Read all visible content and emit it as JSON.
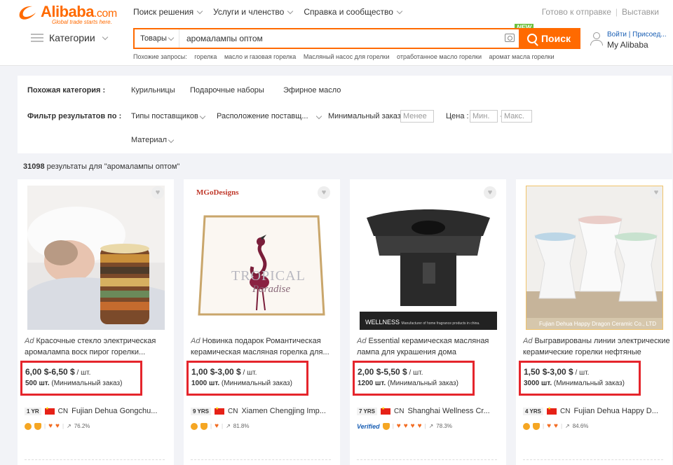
{
  "header": {
    "logo_text": "Alibaba",
    "logo_suffix": ".com",
    "logo_tagline": "Global trade starts here.",
    "nav": [
      {
        "label": "Поиск решения"
      },
      {
        "label": "Услуги и членство"
      },
      {
        "label": "Справка и сообщество"
      }
    ],
    "ready_to_ship": "Готово к отправке",
    "exhibitions": "Выставки",
    "categories_label": "Категории",
    "search": {
      "category": "Товары",
      "query": "аромалампы оптом",
      "button": "Поиск",
      "new_badge": "NEW"
    },
    "account": {
      "links": "Войти | Присоед...",
      "my": "My Alibaba"
    },
    "related_label": "Похожие запросы:",
    "related": [
      "горелка",
      "масло и газовая горелка",
      "Масляный насос для горелки",
      "отработанное масло горелки",
      "аромат масла горелки"
    ]
  },
  "filters": {
    "similar_category_label": "Похожая категория :",
    "similar_categories": [
      "Курильницы",
      "Подарочные наборы",
      "Эфирное масло"
    ],
    "filter_label": "Фильтр результатов по :",
    "supplier_types": "Типы поставщиков",
    "supplier_location": "Расположение поставщ...",
    "min_order_label": "Минимальный заказ :",
    "min_order_placeholder": "Менее",
    "price_label": "Цена :",
    "price_min": "Мин.",
    "price_dash": "-",
    "price_max": "Макс.",
    "material": "Материал"
  },
  "results": {
    "count": "31098",
    "text": " результаты для \"аромалампы оптом\""
  },
  "products": [
    {
      "ad": "Ad",
      "title": "Красочные стекло электрическая аромалампа воск пирог горелки...",
      "price": "6,00 $-6,50 $",
      "unit": " / шт.",
      "moq_qty": "500 шт.",
      "moq_label": " (Минимальный заказ)",
      "years": "1 YR",
      "country": "CN",
      "supplier": "Fujian Dehua Gongchu...",
      "rate": "76.2%"
    },
    {
      "ad": "Ad",
      "title": "Новинка подарок Романтическая керамическая масляная горелка для...",
      "price": "1,00 $-3,00 $",
      "unit": " / шт.",
      "moq_qty": "1000 шт.",
      "moq_label": " (Минимальный заказ)",
      "years": "9 YRS",
      "country": "CN",
      "supplier": "Xiamen Chengjing Imp...",
      "rate": "81.8%",
      "brand": "MGoDesigns",
      "img_text1": "TROPICAL",
      "img_text2": "Paradise"
    },
    {
      "ad": "Ad",
      "title": "Essential керамическая масляная лампа для украшения дома",
      "price": "2,00 $-5,50 $",
      "unit": " / шт.",
      "moq_qty": "1200 шт.",
      "moq_label": " (Минимальный заказ)",
      "years": "7 YRS",
      "country": "CN",
      "supplier": "Shanghai Wellness Cr...",
      "rate": "78.3%",
      "verified": "Verified",
      "banner": "WELLNESS",
      "banner_sub": "Manufacturer of home fragrance products in china."
    },
    {
      "ad": "Ad",
      "title": "Выгравированы линии электрические керамические горелки нефтяные",
      "price": "1,50 $-3,00 $",
      "unit": " / шт.",
      "moq_qty": "3000 шт.",
      "moq_label": " (Минимальный заказ)",
      "years": "4 YRS",
      "country": "CN",
      "supplier": "Fujian Dehua Happy D...",
      "rate": "84.6%",
      "banner": "Fujian Dehua Happy Dragon Ceramic Co., LTD"
    }
  ]
}
